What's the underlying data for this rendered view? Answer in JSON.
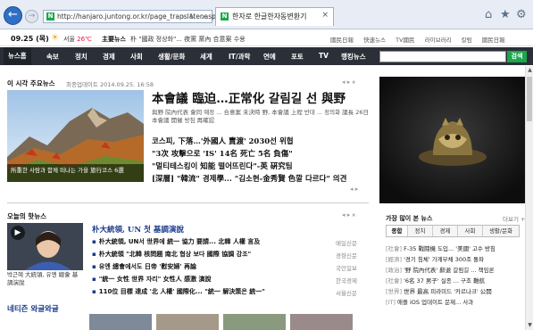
{
  "browser": {
    "url": "http://hanjaro.juntong.or.kr/page_translater.aspx",
    "tab_title": "한자로 한글한자동변환기",
    "search_ctrl": "ρ",
    "refresh_ctrl": "↻",
    "back_glyph": "←",
    "fwd_glyph": "→",
    "close_glyph": "×"
  },
  "site_top": {
    "date": "09.25 (목)",
    "weather": "서울",
    "temp": "26℃",
    "ticker_label": "主要뉴스",
    "ticker_text": "朴 \"國政 정상화\"... 夜黨 黨內 合意案 수용",
    "links": [
      "國民日報",
      "快速뉴스",
      "TV國民",
      "라이브러리",
      "칼럼",
      "國民日報"
    ]
  },
  "nav": {
    "items": [
      "뉴스홈",
      "속보",
      "정치",
      "경제",
      "사회",
      "생활/문화",
      "세계",
      "IT/과학",
      "연예",
      "포토",
      "TV",
      "랭킹뉴스"
    ],
    "search_btn": "검색"
  },
  "main": {
    "section_title": "이 시각 주요뉴스",
    "section_time": "최종업데이트 2014.09.25. 16:58",
    "image_caption": "所重한 사람과 함께 떠나는 가을 旅行코스 6選",
    "headline": "本會議 臨迫…正常化 갈림길 선 與野",
    "summary": "與野 院內代表 會同 예정 ... 合意案 未決時 野, 本會議 上程 반대 ... 정의화 議長 26日 本會議 開催 방침 再確認",
    "sub_news": [
      "코스피, 下落…'外國人 賣渡' 2030선 위협",
      "\"3次 攻擊으로 'IS' 14名 死亡 5名 負傷\"",
      "\"멀티테스킹이 知能 떨어뜨린다\"-英 硏究팀",
      "[深層] \"韓流\" 경제學... \"김소현-金秀賢 色깔 다르다\" 의견"
    ],
    "hot_title": "오늘의 핫뉴스",
    "hot_headline": "朴大統領, UN 첫 基調演說",
    "hot_items": [
      {
        "text": "朴大統領, UN서 世界에 統一 協力 要請... 北韓 人權 言及",
        "src": "매일신문"
      },
      {
        "text": "朴大統領 \"北韓 核問題 南北 협상 보다 國際 協調 강조\"",
        "src": "경향신문"
      },
      {
        "text": "유엔 總會에서도 日帝 '慰安婦' 再論",
        "src": "국민일보"
      },
      {
        "text": "\"統一 女性 世界 자리\" 女性人 感激 演說",
        "src": "한국경제"
      },
      {
        "text": "110位 目標 達成 '北 人權' 國際化... \"統一 解決策은 統一\"",
        "src": "서울신문"
      }
    ],
    "photo_caption": "박근혜 大統領, 유엔 總會 基調演說",
    "netizen_title": "네티즌 와글와글"
  },
  "side": {
    "pop_title": "가장 많이 본 뉴스",
    "pop_more": "더보기 +",
    "pop_tabs": [
      "종합",
      "정치",
      "경제",
      "사회",
      "생활/문화"
    ],
    "pop_items": [
      {
        "cat": "[社會]",
        "text": "F-35 戰鬪機 도입... '美國' 고수 방침"
      },
      {
        "cat": "[經濟]",
        "text": "'경기 침체' 가계부채 300조 돌파"
      },
      {
        "cat": "[政治]",
        "text": "'野 院內代表' 辭退 갈림길 ... 책임론"
      },
      {
        "cat": "[社會]",
        "text": "'6名 37 男子' 실종 ... 구조 難航"
      },
      {
        "cat": "[世界]",
        "text": "世界 最高 피라미드 '카르나크' 公開"
      },
      {
        "cat": "[IT]",
        "text": "애플 iOS 업데이트 문제... 사과"
      }
    ]
  }
}
